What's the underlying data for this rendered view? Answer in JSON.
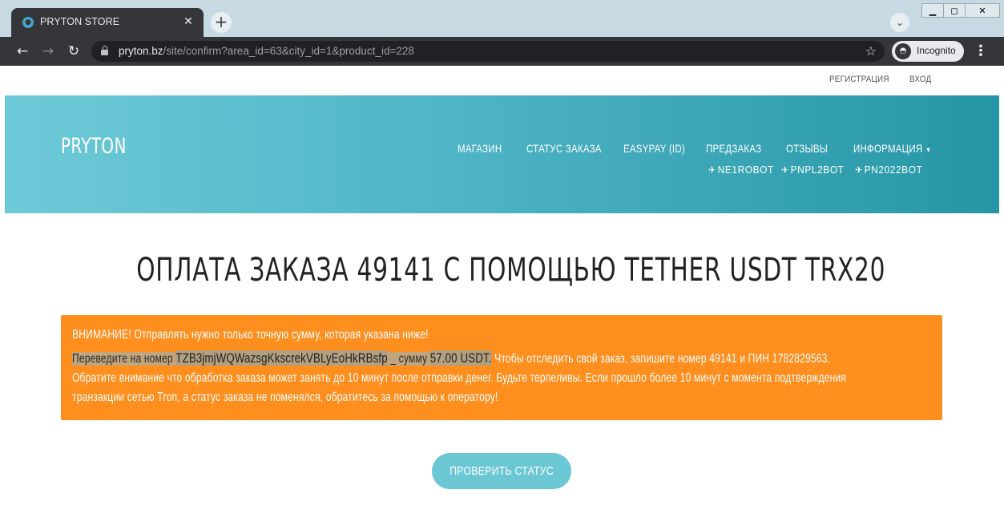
{
  "browser": {
    "tab_title": "PRYTON STORE",
    "url_host": "pryton.bz",
    "url_path": "/site/confirm?area_id=63&city_id=1&product_id=228",
    "incognito_label": "Incognito",
    "tab_close_icon": "close-icon",
    "new_tab_icon": "plus-icon"
  },
  "topbar": {
    "register_label": "РЕГИСТРАЦИЯ",
    "login_label": "ВХОД"
  },
  "header": {
    "logo": "PRYTON",
    "nav": [
      {
        "label": "МАГАЗИН"
      },
      {
        "label": "СТАТУС ЗАКАЗА"
      },
      {
        "label": "EASYPAY (ID)"
      },
      {
        "label": "ПРЕДЗАКАЗ"
      },
      {
        "label": "ОТЗЫВЫ"
      },
      {
        "label": "ИНФОРМАЦИЯ"
      }
    ],
    "bots": [
      {
        "label": "NE1ROBOT"
      },
      {
        "label": "PNPL2BOT"
      },
      {
        "label": "PN2022BOT"
      }
    ]
  },
  "main": {
    "title": "ОПЛАТА ЗАКАЗА 49141 С ПОМОЩЬЮ TETHER USDT TRX20",
    "alert": {
      "warning": "ВНИМАНИЕ! Отправлять нужно только точную сумму, которая указана ниже!",
      "transfer_prefix": "Переведите на номер",
      "wallet": "TZB3jmjWQWazsgKkscrekVBLyEoHkRBsfp",
      "sum_prefix": "_ сумму",
      "amount": "57.00 USDT.",
      "tracking": "Чтобы отследить свой заказ, запишите номер 49141 и ПИН 1782829563.",
      "note_line1": "Обратите внимание что обработка заказа может занять до 10 минут после отправки денег. Будьте терпеливы. Если прошло более 10 минут с момента подтверждения",
      "note_line2": "транзакции сетью Tron, а статус заказа не поменялся, обратитесь за помощью к оператору!"
    },
    "check_button": "ПРОВЕРИТЬ СТАТУС"
  },
  "colors": {
    "header_start": "#6ecad8",
    "header_end": "#2596a6",
    "alert_bg": "#fe8e1e",
    "button_bg": "#6cc7d4"
  }
}
